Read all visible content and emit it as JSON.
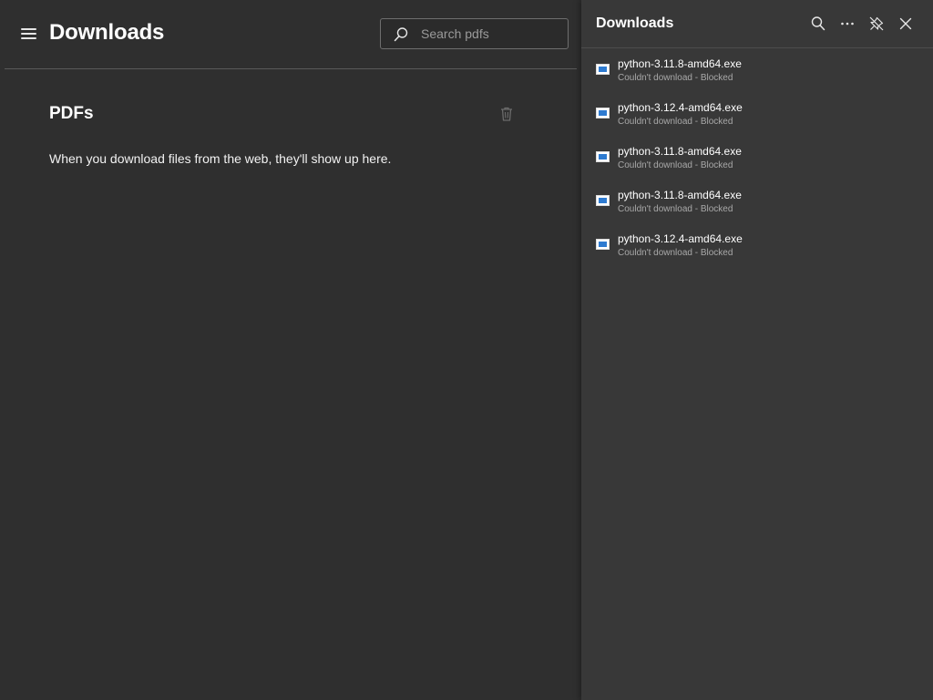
{
  "main": {
    "title": "Downloads",
    "search": {
      "placeholder": "Search pdfs",
      "value": ""
    },
    "section_title": "PDFs",
    "empty_message": "When you download files from the web, they'll show up here."
  },
  "flyout": {
    "title": "Downloads",
    "items": [
      {
        "filename": "python-3.11.8-amd64.exe",
        "status": "Couldn't download - Blocked"
      },
      {
        "filename": "python-3.12.4-amd64.exe",
        "status": "Couldn't download - Blocked"
      },
      {
        "filename": "python-3.11.8-amd64.exe",
        "status": "Couldn't download - Blocked"
      },
      {
        "filename": "python-3.11.8-amd64.exe",
        "status": "Couldn't download - Blocked"
      },
      {
        "filename": "python-3.12.4-amd64.exe",
        "status": "Couldn't download - Blocked"
      }
    ]
  },
  "icons": {
    "menu": "hamburger-icon",
    "search": "search-icon",
    "trash": "trash-icon",
    "more": "more-icon",
    "unpin": "unpin-icon",
    "close": "close-icon",
    "file": "exe-file-icon"
  },
  "colors": {
    "page_background": "#2f2f2f",
    "flyout_background": "#383838",
    "file_icon_accent": "#2e7bd1",
    "secondary_text": "#a8a8a8"
  }
}
